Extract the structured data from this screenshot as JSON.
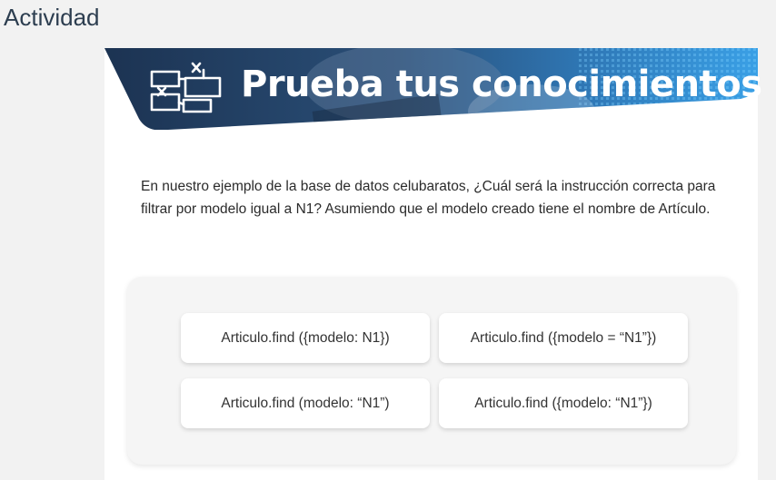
{
  "header": {
    "title": "Actividad"
  },
  "banner": {
    "title": "Prueba tus conocimientos",
    "icon": "flowchart-icon"
  },
  "question": {
    "text": "En nuestro ejemplo de la base de datos celubaratos, ¿Cuál será la instrucción correcta para filtrar por modelo igual a N1? Asumiendo que el modelo creado tiene el nombre de Artículo."
  },
  "options": [
    {
      "label": "Articulo.find ({modelo: N1})"
    },
    {
      "label": "Articulo.find ({modelo = “N1”})"
    },
    {
      "label": "Articulo.find (modelo: “N1”)"
    },
    {
      "label": "Articulo.find ({modelo: “N1”})"
    }
  ],
  "colors": {
    "banner_dark": "#1e3a5c",
    "banner_light": "#2a8fd6",
    "page_bg": "#f2f2f2",
    "title_text": "#2d3e50"
  }
}
